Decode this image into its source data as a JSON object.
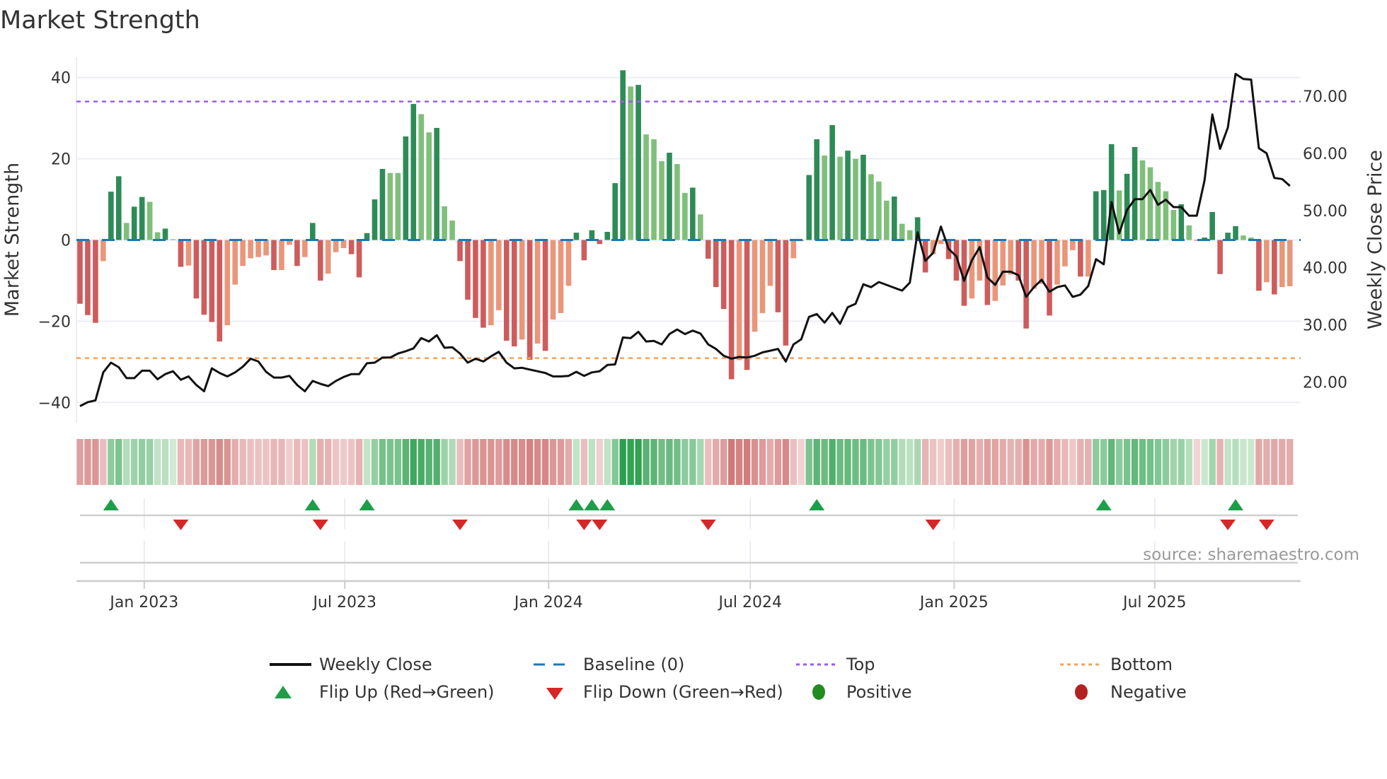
{
  "title": "Market Strength",
  "source": "source: sharemaestro.com",
  "colors": {
    "bar_pos_strong": "#2e8b57",
    "bar_pos_weak": "#7fbf7b",
    "bar_neg_strong": "#cd5c5c",
    "bar_neg_weak": "#e9967a",
    "baseline": "#1f77b4",
    "top": "#9b5de5",
    "bottom": "#f0a35e",
    "line": "#111111",
    "flip_up": "#1e9e4a",
    "flip_down": "#d62728",
    "positive": "#228b22",
    "negative": "#b22222"
  },
  "chart_data": {
    "type": "bar+line",
    "title": "Market Strength",
    "ylabel_left": "Market Strength",
    "ylabel_right": "Weekly Close Price",
    "frequency": "weekly",
    "start_date": "2022-11-04",
    "ylim_left": [
      -45,
      45
    ],
    "ylim_right": [
      12.9,
      76.8
    ],
    "left_ticks": [
      "40",
      "20",
      "0",
      "−20",
      "−40"
    ],
    "left_tick_values": [
      40,
      20,
      0,
      -20,
      -40
    ],
    "right_ticks": [
      "70.00",
      "60.00",
      "50.00",
      "40.00",
      "30.00",
      "20.00"
    ],
    "right_tick_values": [
      70,
      60,
      50,
      40,
      30,
      20
    ],
    "x_ticks": [
      {
        "label": "Jan 2023",
        "date": "2023-01-01"
      },
      {
        "label": "Jul 2023",
        "date": "2023-07-01"
      },
      {
        "label": "Jan 2024",
        "date": "2024-01-01"
      },
      {
        "label": "Jul 2024",
        "date": "2024-07-01"
      },
      {
        "label": "Jan 2025",
        "date": "2025-01-01"
      },
      {
        "label": "Jul 2025",
        "date": "2025-07-01"
      }
    ],
    "top_level": 34.1,
    "bottom_level": -29.1,
    "grid": true,
    "strength": [
      -15.7,
      -18.5,
      -20.4,
      -5.2,
      11.9,
      15.7,
      4.2,
      8.2,
      10.6,
      9.4,
      1.9,
      2.8,
      0.2,
      -6.6,
      -6.3,
      -14.4,
      -18.4,
      -20.2,
      -25,
      -21,
      -11,
      -6.4,
      -4.5,
      -4.2,
      -3.8,
      -7.4,
      -7.4,
      -1.2,
      -6.4,
      -4.2,
      4.2,
      -10,
      -8.3,
      -3,
      -2,
      -3.5,
      -9.2,
      1.7,
      10,
      17.5,
      16.5,
      16.5,
      25.5,
      33.5,
      31,
      26.5,
      27.6,
      8.3,
      4.8,
      -5.2,
      -14.7,
      -19.2,
      -21.6,
      -21,
      -17.3,
      -24.8,
      -26.2,
      -24.5,
      -29.5,
      -25.5,
      -27.3,
      -19.6,
      -18,
      -11.3,
      1.8,
      -5,
      2.4,
      -1,
      2,
      14,
      41.8,
      37.8,
      38.2,
      26,
      24.8,
      19.4,
      21.5,
      18.7,
      11.6,
      12.9,
      6.3,
      -4.6,
      -11.6,
      -17,
      -34.3,
      -29.6,
      -32,
      -22.6,
      -18,
      -11.3,
      -17.8,
      -26,
      -4.5,
      -0.3,
      16,
      24.8,
      20.8,
      28.3,
      20.5,
      22,
      20,
      21,
      16.2,
      14.4,
      9.7,
      10.7,
      4,
      2.4,
      5.6,
      -8,
      -3.5,
      -1,
      -4.7,
      -10,
      -16.2,
      -14.4,
      -10,
      -16,
      -15,
      -11.2,
      -8.5,
      -10,
      -21.8,
      -12,
      -10.8,
      -18.6,
      -11,
      -6.5,
      -2.5,
      -9,
      -9,
      12,
      12.3,
      23.6,
      12.2,
      16.3,
      22.9,
      19.6,
      17.9,
      14.3,
      12,
      7.4,
      8.8,
      3.6,
      -0.1,
      0.6,
      6.9,
      -8.4,
      1.8,
      3.4,
      1.1,
      0.6,
      -12.5,
      -10.4,
      -13.4,
      -11.6,
      -11.4
    ],
    "weekly_close": [
      15.8,
      16.5,
      16.8,
      21.7,
      23.4,
      22.6,
      20.7,
      20.7,
      22.0,
      22.0,
      20.5,
      21.4,
      21.9,
      20.4,
      21.0,
      19.5,
      18.4,
      22.4,
      21.6,
      21.0,
      21.7,
      22.7,
      24.1,
      23.6,
      21.8,
      20.8,
      20.8,
      21.1,
      19.5,
      18.4,
      20.2,
      19.7,
      19.3,
      20.2,
      20.9,
      21.4,
      21.4,
      23.3,
      23.4,
      24.3,
      24.3,
      25.0,
      25.4,
      25.9,
      27.7,
      27.1,
      28.2,
      26.0,
      26.1,
      25.0,
      23.4,
      24.1,
      23.6,
      24.5,
      25.3,
      23.4,
      22.4,
      22.5,
      22.2,
      21.9,
      21.6,
      21.0,
      21.0,
      21.1,
      21.8,
      21.1,
      21.7,
      21.9,
      23.0,
      23.1,
      27.8,
      27.7,
      28.8,
      27.1,
      27.2,
      26.6,
      28.4,
      29.2,
      28.4,
      29.0,
      28.5,
      26.6,
      25.8,
      24.6,
      24.1,
      24.4,
      24.3,
      24.6,
      25.2,
      25.5,
      25.8,
      23.6,
      26.6,
      27.5,
      31.4,
      31.9,
      30.4,
      32.1,
      30.2,
      33.1,
      33.7,
      37.1,
      36.6,
      37.5,
      37.0,
      36.5,
      36.0,
      37.4,
      46.2,
      41.2,
      42.6,
      47.2,
      43.3,
      42.0,
      37.7,
      41.3,
      43.6,
      38.3,
      37.0,
      39.3,
      39.3,
      38.7,
      34.9,
      36.6,
      37.9,
      35.8,
      36.6,
      36.9,
      34.9,
      35.3,
      36.8,
      41.5,
      40.6,
      51.5,
      46.0,
      50.1,
      52.0,
      52.0,
      53.6,
      51.0,
      51.9,
      50.6,
      50.6,
      49.1,
      49.1,
      55.3,
      66.8,
      60.8,
      64.5,
      73.9,
      73.0,
      72.9,
      60.9,
      60.0,
      55.7,
      55.5,
      54.3
    ],
    "flip_up_weeks": [
      4,
      30,
      37,
      64,
      66,
      68,
      95,
      132,
      149
    ],
    "flip_down_weeks": [
      13,
      31,
      49,
      65,
      67,
      81,
      110,
      148,
      153
    ],
    "legend_placement": "bottom",
    "legend": {
      "weekly_close": "Weekly Close",
      "baseline": "Baseline (0)",
      "top": "Top",
      "bottom": "Bottom",
      "flip_up": "Flip Up (Red→Green)",
      "flip_down": "Flip Down (Green→Red)",
      "positive": "Positive",
      "negative": "Negative"
    }
  }
}
